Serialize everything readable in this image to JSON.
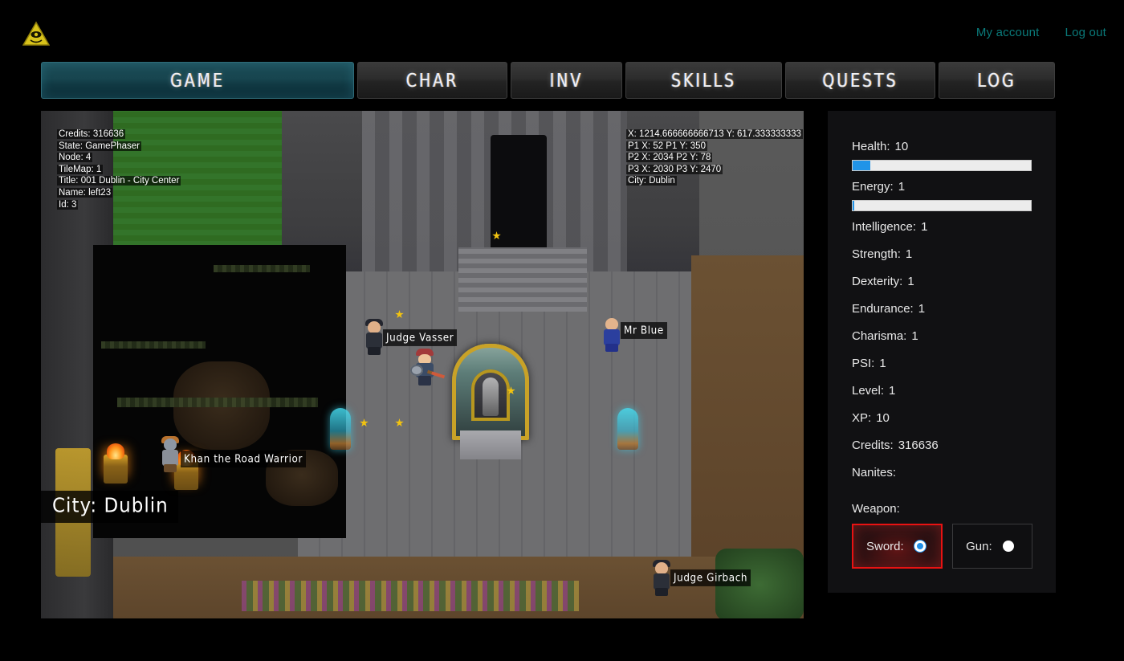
{
  "header": {
    "logo_icon": "illuminati-eye-triangle-icon",
    "links": [
      {
        "label": "My account"
      },
      {
        "label": "Log out"
      }
    ]
  },
  "tabs": [
    {
      "label": "GAME",
      "active": true
    },
    {
      "label": "CHAR",
      "active": false
    },
    {
      "label": "INV",
      "active": false
    },
    {
      "label": "SKILLS",
      "active": false
    },
    {
      "label": "QUESTS",
      "active": false
    },
    {
      "label": "LOG",
      "active": false
    }
  ],
  "game": {
    "debug_left": [
      "Credits: 316636",
      "State: GamePhaser",
      "Node: 4",
      "TileMap: 1",
      "Title: 001 Dublin - City Center",
      "Name: left23",
      "Id: 3"
    ],
    "debug_right": [
      "X: 1214.666666666713 Y: 617.333333333",
      "P1 X: 52 P1 Y: 350",
      "P2 X: 2034 P2 Y: 78",
      "P3 X: 2030 P3 Y: 2470",
      "City: Dublin"
    ],
    "city_banner": "City: Dublin",
    "npcs": [
      {
        "name": "Khan the Road Warrior"
      },
      {
        "name": "Judge Vasser"
      },
      {
        "name": "Mr Blue"
      },
      {
        "name": "Judge Girbach"
      }
    ]
  },
  "stats": {
    "health": {
      "label": "Health:",
      "value": "10",
      "percent": 10
    },
    "energy": {
      "label": "Energy:",
      "value": "1",
      "percent": 1
    },
    "intelligence": {
      "label": "Intelligence:",
      "value": "1"
    },
    "strength": {
      "label": "Strength:",
      "value": "1"
    },
    "dexterity": {
      "label": "Dexterity:",
      "value": "1"
    },
    "endurance": {
      "label": "Endurance:",
      "value": "1"
    },
    "charisma": {
      "label": "Charisma:",
      "value": "1"
    },
    "psi": {
      "label": "PSI:",
      "value": "1"
    },
    "level": {
      "label": "Level:",
      "value": "1"
    },
    "xp": {
      "label": "XP:",
      "value": "10"
    },
    "credits": {
      "label": "Credits:",
      "value": "316636"
    },
    "nanites": {
      "label": "Nanites:",
      "value": ""
    },
    "weapon": {
      "label": "Weapon:",
      "options": [
        {
          "label": "Sword:",
          "selected": true
        },
        {
          "label": "Gun:",
          "selected": false
        }
      ]
    }
  },
  "colors": {
    "accent_teal": "#0a7a7a",
    "bar_blue": "#2194e8",
    "selection_red": "#e81212",
    "tab_active": "#17454f"
  }
}
